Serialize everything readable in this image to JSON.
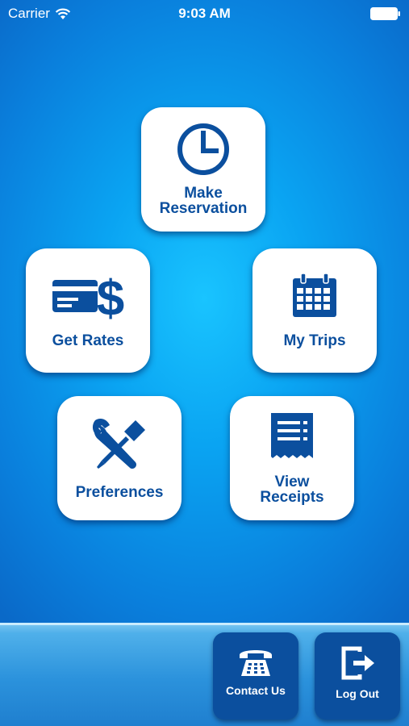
{
  "status": {
    "carrier": "Carrier",
    "time": "9:03 AM"
  },
  "menu": {
    "make_reservation": "Make\nReservation",
    "get_rates": "Get Rates",
    "my_trips": "My Trips",
    "preferences": "Preferences",
    "view_receipts": "View\nReceipts"
  },
  "footer": {
    "contact_us": "Contact Us",
    "log_out": "Log Out"
  },
  "colors": {
    "accent": "#0b4f9e",
    "background": "#0a8fe6"
  }
}
